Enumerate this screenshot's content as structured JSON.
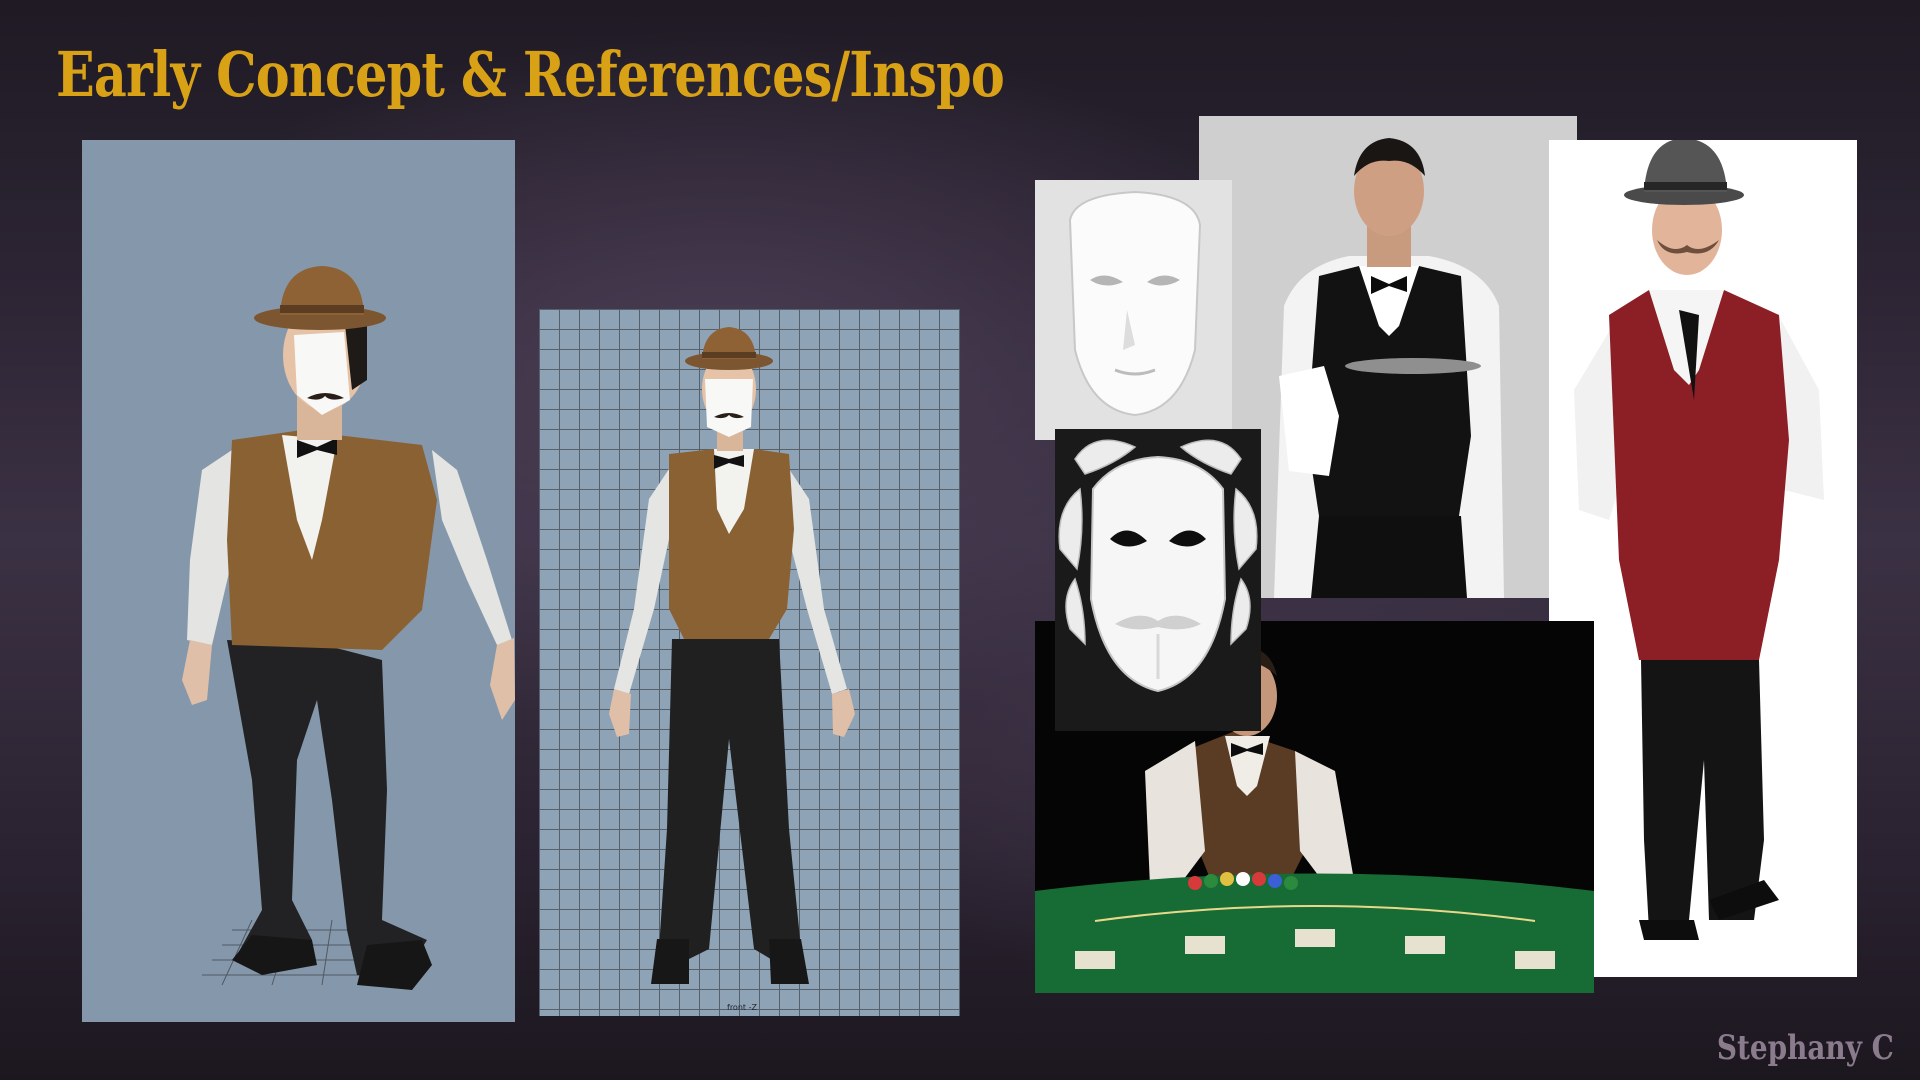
{
  "slide": {
    "title": "Early Concept & References/Inspo",
    "credit": "Stephany C"
  },
  "panels": {
    "render_front_label": "front -Z"
  },
  "colors": {
    "title": "#d9a116",
    "credit": "#8a7c8d",
    "viewport_bg": "#8598ab"
  }
}
